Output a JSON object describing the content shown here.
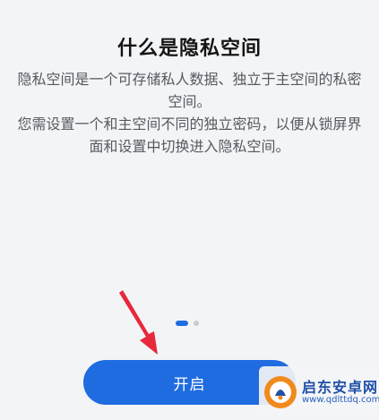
{
  "page": {
    "title": "什么是隐私空间",
    "description_line1": "隐私空间是一个可存储私人数据、独立于主空间的私密空间。",
    "description_line2": "您需设置一个和主空间不同的独立密码，以便从锁屏界面和设置中切换进入隐私空间。"
  },
  "pager": {
    "total": 2,
    "active": 1
  },
  "actions": {
    "start_label": "开启"
  },
  "watermark": {
    "name": "启东安卓网",
    "url": "www.qdlttdq.com"
  },
  "colors": {
    "accent": "#1f6be0",
    "background": "#f3f4f6",
    "arrow": "#e8283b",
    "watermark_orange": "#f08a1c"
  },
  "icons": {
    "annotation": "red-arrow-icon",
    "watermark_logo": "qidong-logo-icon"
  }
}
